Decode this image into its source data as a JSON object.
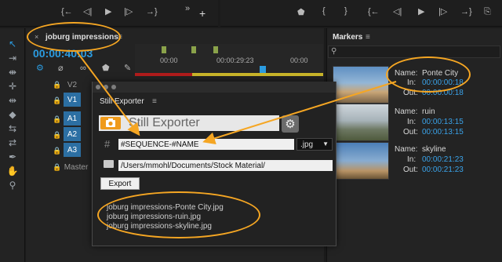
{
  "timeline": {
    "sequence_tab": "joburg impressions",
    "timecode": "00:00:40:03",
    "ruler_times": [
      "00:00",
      "00:00:29:23",
      "00:00"
    ],
    "tracks": [
      {
        "label": "V2"
      },
      {
        "label": "V1"
      },
      {
        "label": "A1"
      },
      {
        "label": "A2"
      },
      {
        "label": "A3"
      },
      {
        "label": "Master"
      }
    ]
  },
  "markers": {
    "title": "Markers",
    "items": [
      {
        "name_label": "Name:",
        "name": "Ponte City",
        "in_label": "In:",
        "in": "00:00:00:18",
        "out_label": "Out:",
        "out": "00:00:00:18"
      },
      {
        "name_label": "Name:",
        "name": "ruin",
        "in_label": "In:",
        "in": "00:00:13:15",
        "out_label": "Out:",
        "out": "00:00:13:15"
      },
      {
        "name_label": "Name:",
        "name": "skyline",
        "in_label": "In:",
        "in": "00:00:21:23",
        "out_label": "Out:",
        "out": "00:00:21:23"
      }
    ]
  },
  "exporter": {
    "panel_title": "Still Exporter",
    "header_title": "Still Exporter",
    "hash_symbol": "#",
    "filename_pattern": "#SEQUENCE-#NAME",
    "format": ".jpg",
    "folder_path": "/Users/mmohl/Documents/Stock Material/",
    "export_label": "Export",
    "outputs": [
      "joburg impressions-Ponte City.jpg",
      "joburg impressions-ruin.jpg",
      "joburg impressions-skyline.jpg"
    ]
  },
  "colors": {
    "accent_blue": "#2b9be0",
    "annotation_orange": "#f5a623",
    "track_blue": "#2c6fa3",
    "exporter_orange": "#ef9a1a"
  }
}
